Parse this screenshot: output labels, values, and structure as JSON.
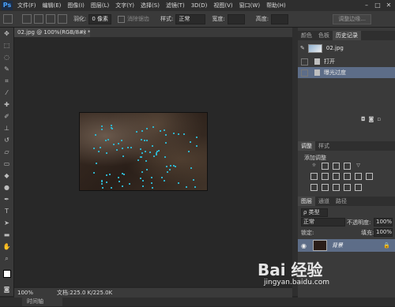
{
  "app": {
    "logo": "Ps"
  },
  "menu": [
    "文件(F)",
    "编辑(E)",
    "图像(I)",
    "图层(L)",
    "文字(Y)",
    "选择(S)",
    "滤镜(T)",
    "3D(D)",
    "视图(V)",
    "窗口(W)",
    "帮助(H)"
  ],
  "options": {
    "feather_label": "羽化:",
    "feather_value": "0 像素",
    "antialias_label": "消除锯齿",
    "style_label": "样式:",
    "style_value": "正常",
    "width_label": "宽度:",
    "height_label": "高度:",
    "refine_edge": "调整边缘..."
  },
  "document": {
    "tab_title": "02.jpg @ 100%(RGB/8#) *",
    "zoom": "100%",
    "doc_size": "文档:225.0 K/225.0K"
  },
  "history_panel": {
    "tabs": [
      "颜色",
      "色板",
      "历史记录"
    ],
    "snapshot": "02.jpg",
    "steps": [
      "打开",
      "曝光过度"
    ]
  },
  "adjust_panel": {
    "tabs": [
      "调整",
      "样式"
    ],
    "title": "添加调整"
  },
  "layers_panel": {
    "tabs": [
      "图层",
      "通道",
      "路径"
    ],
    "kind_label": "ρ 类型",
    "blend_mode": "正常",
    "opacity_label": "不透明度:",
    "opacity": "100%",
    "lock_label": "锁定:",
    "fill_label": "填充:",
    "fill": "100%",
    "layer_name": "背景"
  },
  "bottom": {
    "tab": "时间轴"
  },
  "watermark": {
    "text": "Bai 经验",
    "url": "jingyan.baidu.com"
  },
  "colors": {
    "accent": "#5d6d88",
    "ps_blue": "#49a3ff",
    "speck": "#2fb1c9"
  }
}
